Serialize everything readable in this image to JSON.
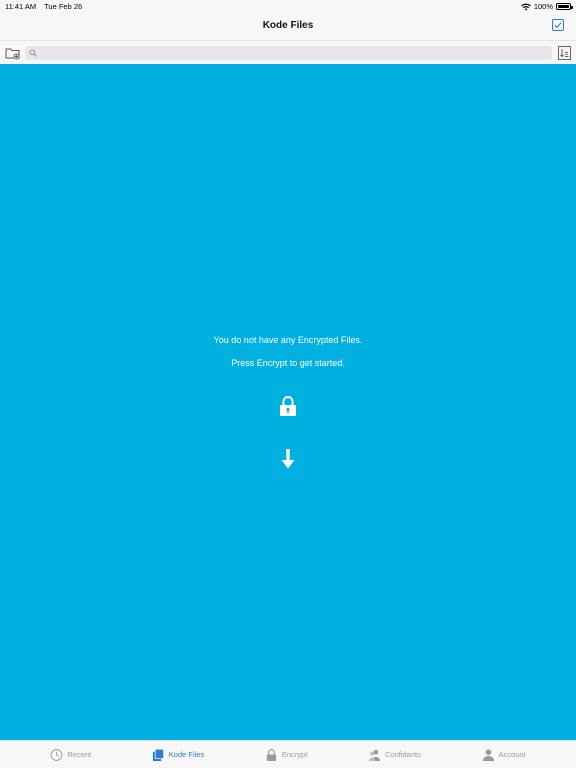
{
  "status_bar": {
    "time": "11:41 AM",
    "date": "Tue Feb 26",
    "battery": "100%"
  },
  "nav": {
    "title": "Kode Files"
  },
  "search": {
    "placeholder": "",
    "value": ""
  },
  "content": {
    "message_1": "You do not have any Encrypted Files.",
    "message_2": "Press Encrypt to get started.",
    "background_color": "#00b0e0"
  },
  "tabs": [
    {
      "label": "Recent",
      "icon": "clock-icon",
      "active": false
    },
    {
      "label": "Kode Files",
      "icon": "files-icon",
      "active": true
    },
    {
      "label": "Encrypt",
      "icon": "lock-icon",
      "active": false
    },
    {
      "label": "Confidants",
      "icon": "people-icon",
      "active": false
    },
    {
      "label": "Account",
      "icon": "person-icon",
      "active": false
    }
  ],
  "colors": {
    "accent": "#2a7bd5",
    "inactive": "#999999"
  }
}
